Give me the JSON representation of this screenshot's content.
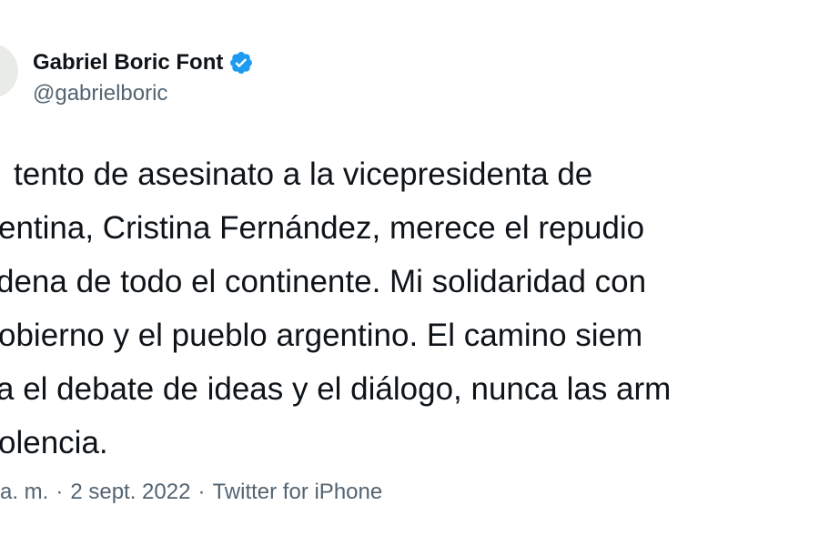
{
  "tweet": {
    "author": {
      "display_name": "Gabriel Boric Font",
      "handle": "@gabrielboric",
      "verified": true,
      "verified_color": "#1d9bf0"
    },
    "text_lines": [
      "tento de asesinato a la vicepresidenta de",
      "entina, Cristina Fernández, merece el repudio",
      "dena de todo el continente. Mi solidaridad con",
      "obierno y el pueblo argentino. El camino siem",
      "a el debate de ideas y el diálogo, nunca las arm",
      "olencia."
    ],
    "meta": {
      "time": "a. m.",
      "separator": "·",
      "date": "2 sept. 2022",
      "source": "Twitter for iPhone"
    }
  }
}
